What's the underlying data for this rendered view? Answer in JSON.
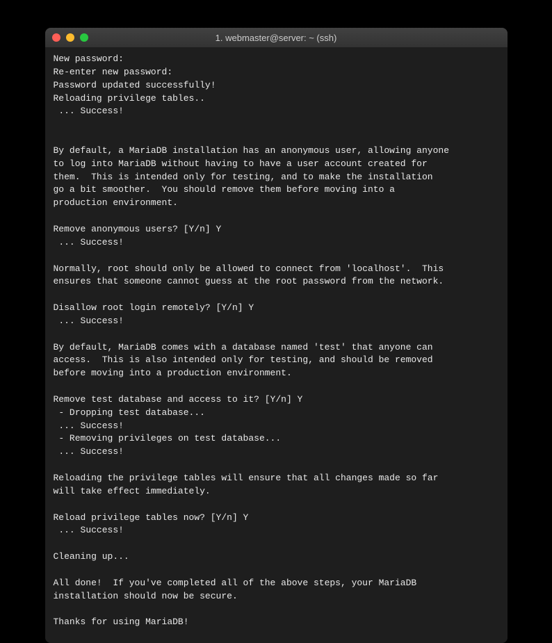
{
  "window": {
    "title": "1. webmaster@server: ~ (ssh)"
  },
  "terminal": {
    "content": "New password:\nRe-enter new password:\nPassword updated successfully!\nReloading privilege tables..\n ... Success!\n\n\nBy default, a MariaDB installation has an anonymous user, allowing anyone\nto log into MariaDB without having to have a user account created for\nthem.  This is intended only for testing, and to make the installation\ngo a bit smoother.  You should remove them before moving into a\nproduction environment.\n\nRemove anonymous users? [Y/n] Y\n ... Success!\n\nNormally, root should only be allowed to connect from 'localhost'.  This\nensures that someone cannot guess at the root password from the network.\n\nDisallow root login remotely? [Y/n] Y\n ... Success!\n\nBy default, MariaDB comes with a database named 'test' that anyone can\naccess.  This is also intended only for testing, and should be removed\nbefore moving into a production environment.\n\nRemove test database and access to it? [Y/n] Y\n - Dropping test database...\n ... Success!\n - Removing privileges on test database...\n ... Success!\n\nReloading the privilege tables will ensure that all changes made so far\nwill take effect immediately.\n\nReload privilege tables now? [Y/n] Y\n ... Success!\n\nCleaning up...\n\nAll done!  If you've completed all of the above steps, your MariaDB\ninstallation should now be secure.\n\nThanks for using MariaDB!"
  },
  "colors": {
    "window_bg": "#1e1e1e",
    "titlebar_bg": "#3a3a3a",
    "text": "#e8e8e8",
    "red": "#ff5f57",
    "yellow": "#febc2e",
    "green": "#28c840"
  }
}
